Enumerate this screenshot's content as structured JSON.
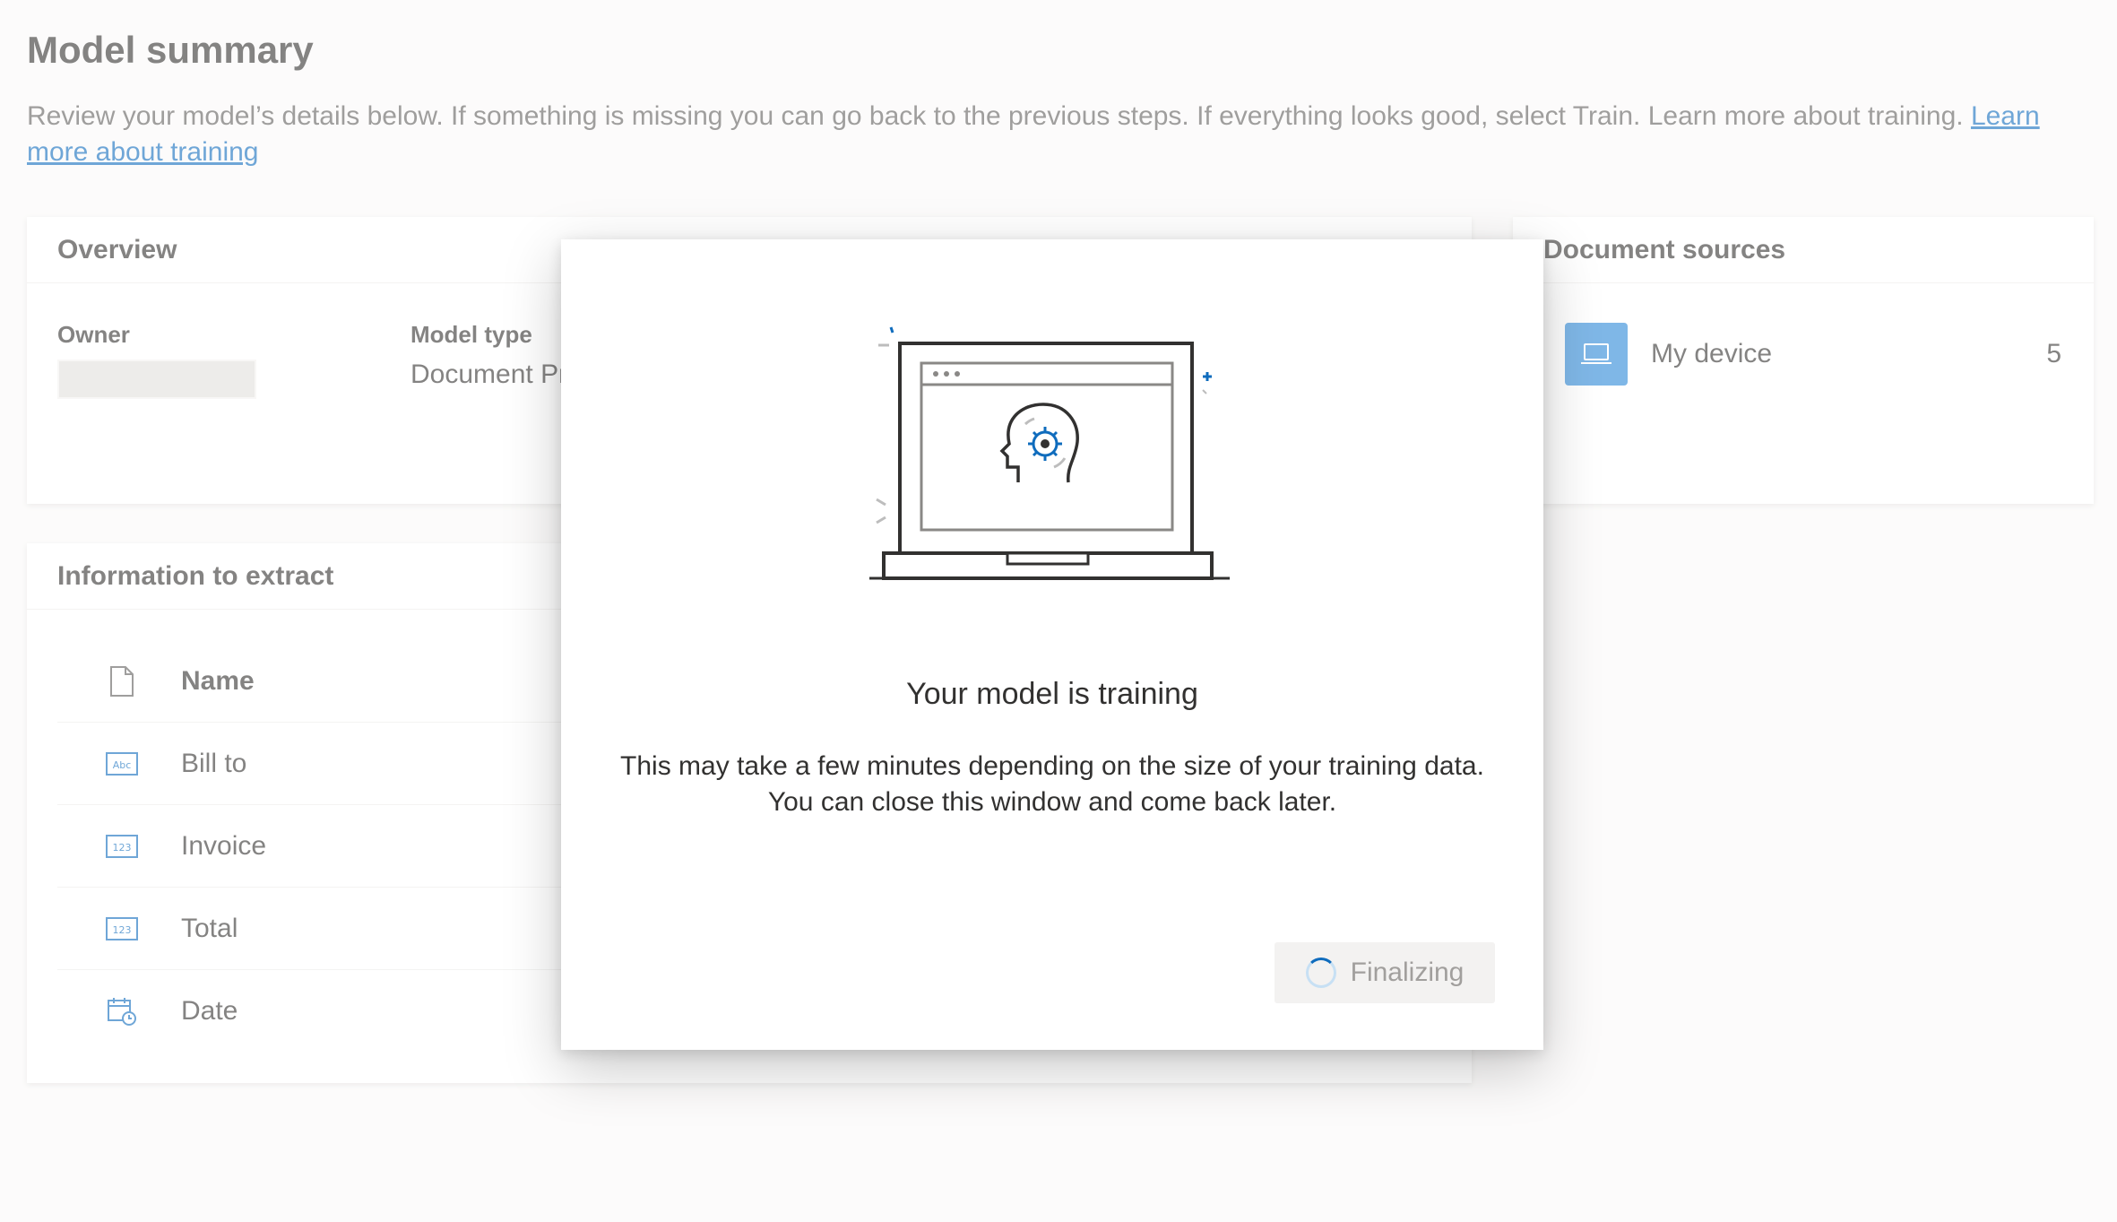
{
  "page": {
    "title": "Model summary",
    "description": "Review your model’s details below. If something is missing you can go back to the previous steps. If everything looks good, select Train. Learn more about training.",
    "learn_more_link": "Learn more about training"
  },
  "overview": {
    "header": "Overview",
    "owner_label": "Owner",
    "model_type_label": "Model type",
    "model_type_value": "Document Pr"
  },
  "information": {
    "header": "Information to extract",
    "column_header": "Name",
    "rows": [
      {
        "label": "Bill to",
        "icon": "text-field-icon"
      },
      {
        "label": "Invoice",
        "icon": "number-field-icon"
      },
      {
        "label": "Total",
        "icon": "number-field-icon"
      },
      {
        "label": "Date",
        "icon": "calendar-icon"
      }
    ]
  },
  "sources": {
    "header": "Document sources",
    "items": [
      {
        "name": "My device",
        "count": "5",
        "icon": "laptop-icon"
      }
    ]
  },
  "dialog": {
    "title": "Your model is training",
    "body_line1": "This may take a few minutes depending on the size of your training data.",
    "body_line2": "You can close this window and come back later.",
    "button_label": "Finalizing",
    "button_enabled": false,
    "illustration": "laptop-brain-gear-icon"
  },
  "colors": {
    "accent": "#0f6cbd",
    "source_icon_bg": "#2b88d8",
    "disabled_text": "#a19f9d"
  }
}
